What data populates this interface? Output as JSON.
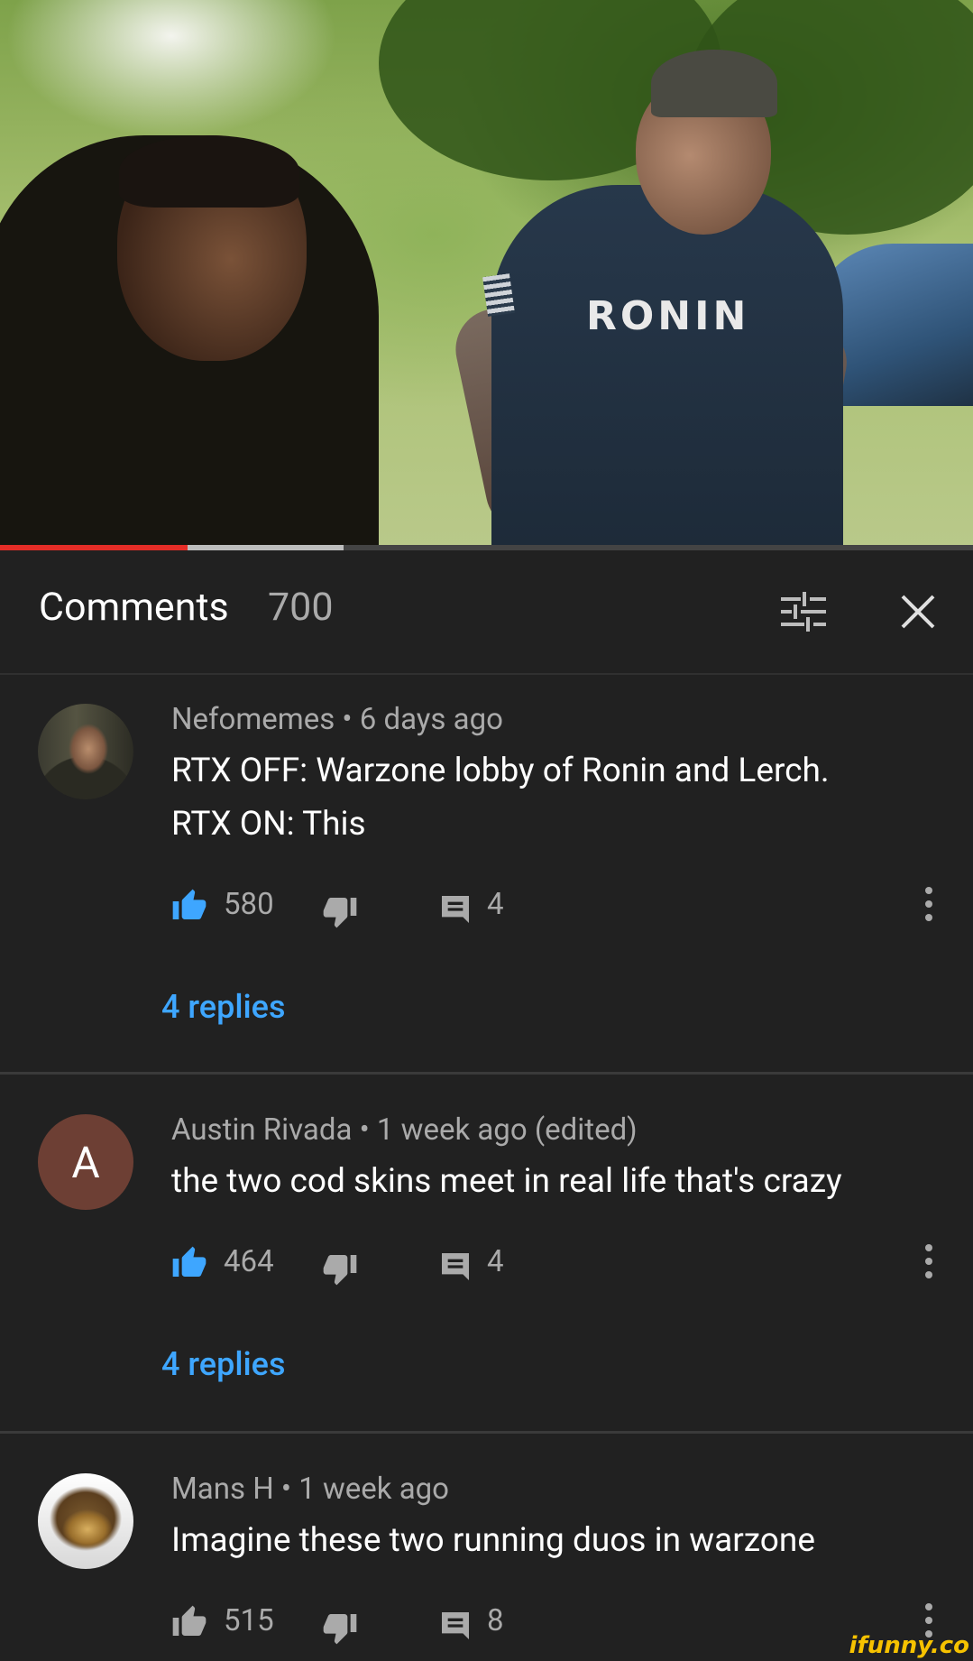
{
  "video": {
    "progress": {
      "played_fraction": 0.193,
      "buffered_fraction": 0.353
    },
    "shirt_text": "RONIN"
  },
  "comments_panel": {
    "title": "Comments",
    "count": "700",
    "sort_icon": "sort-filter-icon",
    "close_icon": "close-icon"
  },
  "colors": {
    "link": "#3ea6ff",
    "like_active": "#3ea6ff",
    "background": "#212121",
    "secondary_text": "#aaaaaa"
  },
  "comments": [
    {
      "author": "Nefomemes",
      "time": "6 days ago",
      "meta": "Nefomemes • 6 days ago",
      "text_lines": [
        "RTX OFF: Warzone lobby of Ronin and Lerch.",
        "RTX ON: This"
      ],
      "likes": "580",
      "liked": true,
      "replies_count": "4",
      "replies_link": "4 replies",
      "avatar": "photo"
    },
    {
      "author": "Austin Rivada",
      "time": "1 week ago (edited)",
      "meta": "Austin Rivada • 1 week ago (edited)",
      "text_lines": [
        "the two cod skins meet in real life that's crazy"
      ],
      "likes": "464",
      "liked": true,
      "replies_count": "4",
      "replies_link": "4 replies",
      "avatar": "A"
    },
    {
      "author": "Mans H",
      "time": "1 week ago",
      "meta": "Mans H • 1 week ago",
      "text_lines": [
        "Imagine these two running duos in warzone"
      ],
      "likes": "515",
      "liked": false,
      "replies_count": "8",
      "avatar": "photo"
    }
  ],
  "watermark": "ifunny.co"
}
